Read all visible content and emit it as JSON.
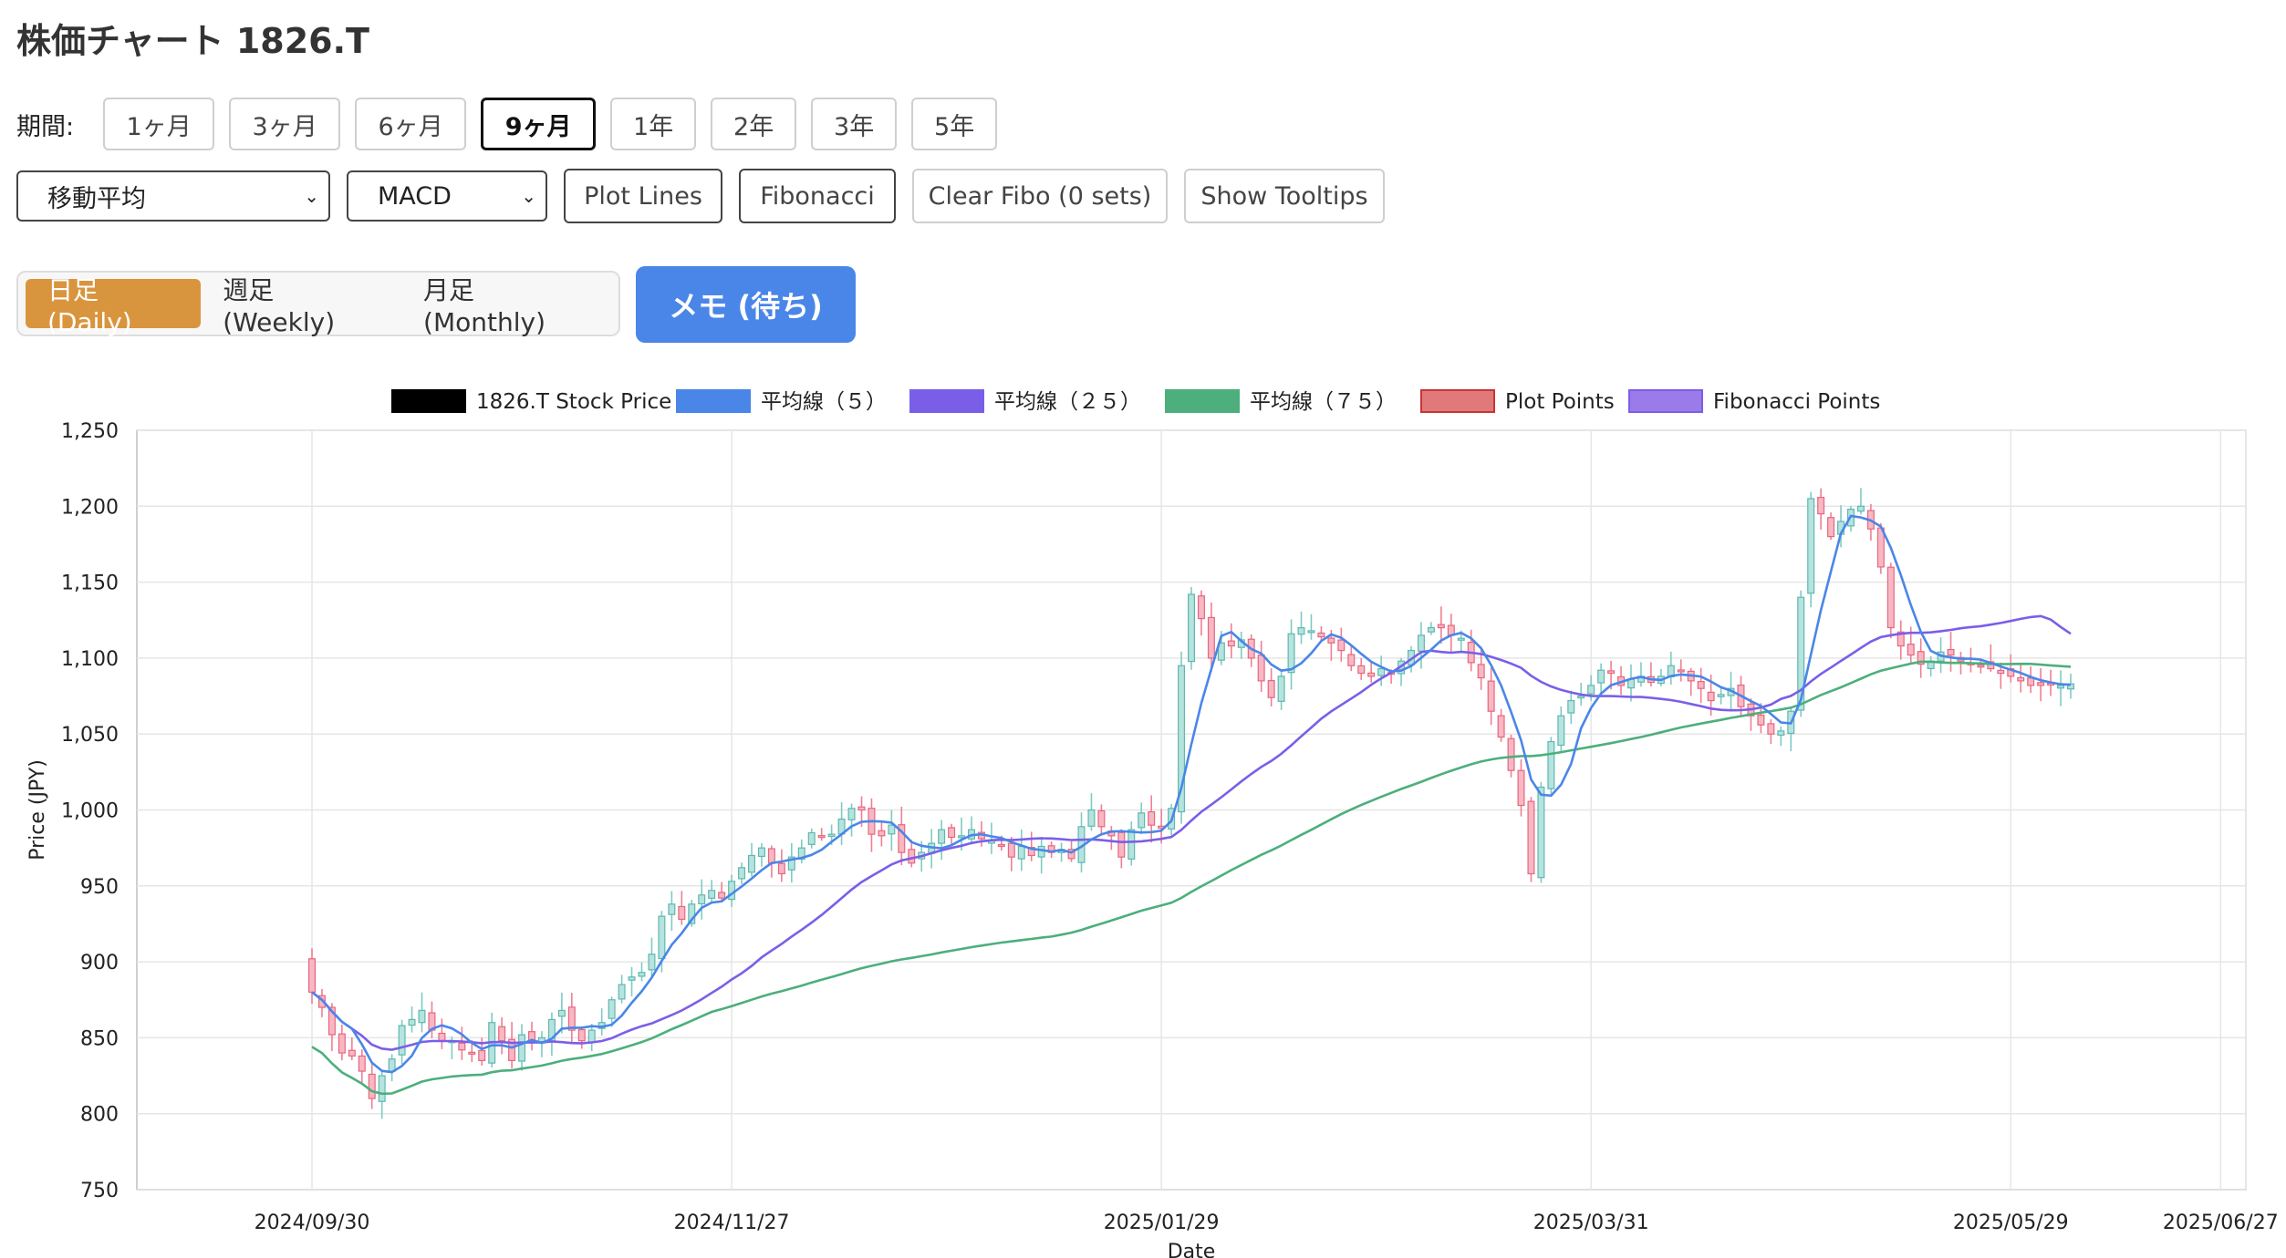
{
  "page_title": "株価チャート 1826.T",
  "period": {
    "label": "期間:",
    "buttons": [
      "1ヶ月",
      "3ヶ月",
      "6ヶ月",
      "9ヶ月",
      "1年",
      "2年",
      "3年",
      "5年"
    ],
    "active": "9ヶ月"
  },
  "controls": {
    "ma_select": "移動平均",
    "indicator_select": "MACD",
    "plot_lines": "Plot Lines",
    "fibonacci": "Fibonacci",
    "clear_fibo": "Clear Fibo (0 sets)",
    "show_tooltips": "Show Tooltips"
  },
  "timeframe": {
    "daily": "日足 (Daily)",
    "weekly": "週足 (Weekly)",
    "monthly": "月足 (Monthly)",
    "active": "daily"
  },
  "memo_button": "メモ (待ち)",
  "colors": {
    "up": "#7ecbc4",
    "down": "#f07f93",
    "ma5": "#4a86e8",
    "ma25": "#7b5ee8",
    "ma75": "#4caf7c",
    "accent": "#d9953e",
    "primary": "#4a86e8"
  },
  "chart_data": {
    "type": "candlestick",
    "legend": [
      {
        "name": "1826.T Stock Price",
        "color": "#000000",
        "border": "#000000"
      },
      {
        "name": "平均線（５）",
        "color": "#4a86e8",
        "border": "#4a86e8"
      },
      {
        "name": "平均線（２５）",
        "color": "#7b5ee8",
        "border": "#7b5ee8"
      },
      {
        "name": "平均線（７５）",
        "color": "#4caf7c",
        "border": "#4caf7c"
      },
      {
        "name": "Plot Points",
        "color": "#e07a7a",
        "border": "#cc3333"
      },
      {
        "name": "Fibonacci Points",
        "color": "#9b7bea",
        "border": "#7b5ee8"
      }
    ],
    "ylabel": "Price (JPY)",
    "xlabel": "Date",
    "ylim": [
      750,
      1250
    ],
    "yticks": [
      "750",
      "800",
      "850",
      "900",
      "950",
      "1,000",
      "1,050",
      "1,100",
      "1,150",
      "1,200",
      "1,250"
    ],
    "xticks": [
      "2024/09/30",
      "2024/11/27",
      "2025/01/29",
      "2025/03/31",
      "2025/05/29",
      "2025/06/27"
    ],
    "grid": true,
    "legend_position": "top",
    "closes": [
      880,
      870,
      852,
      840,
      838,
      828,
      810,
      825,
      836,
      858,
      862,
      868,
      855,
      848,
      848,
      842,
      840,
      835,
      860,
      848,
      835,
      852,
      848,
      850,
      862,
      868,
      855,
      848,
      855,
      860,
      875,
      885,
      890,
      893,
      905,
      930,
      938,
      928,
      938,
      944,
      947,
      942,
      953,
      962,
      970,
      975,
      965,
      958,
      969,
      975,
      985,
      982,
      984,
      994,
      1001,
      1000,
      984,
      983,
      990,
      972,
      965,
      972,
      978,
      987,
      982,
      983,
      987,
      981,
      980,
      977,
      969,
      976,
      970,
      976,
      972,
      974,
      968,
      989,
      1000,
      989,
      983,
      969,
      987,
      998,
      990,
      988,
      1001,
      1095,
      1142,
      1126,
      1100,
      1110,
      1108,
      1112,
      1100,
      1085,
      1074,
      1088,
      1116,
      1120,
      1118,
      1114,
      1110,
      1105,
      1095,
      1090,
      1088,
      1093,
      1090,
      1098,
      1105,
      1115,
      1120,
      1120,
      1115,
      1113,
      1097,
      1087,
      1065,
      1048,
      1026,
      1003,
      958,
      1015,
      1045,
      1062,
      1072,
      1075,
      1082,
      1092,
      1090,
      1082,
      1086,
      1088,
      1084,
      1088,
      1095,
      1091,
      1085,
      1080,
      1072,
      1076,
      1080,
      1068,
      1062,
      1056,
      1050,
      1052,
      1065,
      1140,
      1205,
      1195,
      1180,
      1190,
      1198,
      1200,
      1185,
      1160,
      1120,
      1108,
      1102,
      1096,
      1098,
      1104,
      1102,
      1098,
      1096,
      1095,
      1093,
      1090,
      1088,
      1085,
      1082,
      1082,
      1083,
      1082,
      1083
    ]
  }
}
